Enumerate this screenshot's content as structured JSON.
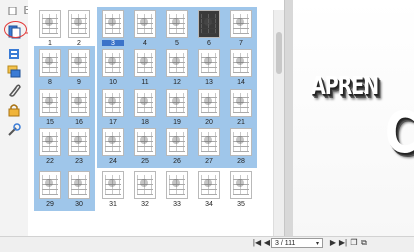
{
  "thumbnails": {
    "pages": [
      {
        "n": "1"
      },
      {
        "n": "2"
      },
      {
        "n": "3"
      },
      {
        "n": "4"
      },
      {
        "n": "5"
      },
      {
        "n": "6"
      },
      {
        "n": "7"
      },
      {
        "n": "8"
      },
      {
        "n": "9"
      },
      {
        "n": "10"
      },
      {
        "n": "11"
      },
      {
        "n": "12"
      },
      {
        "n": "13"
      },
      {
        "n": "14"
      },
      {
        "n": "15"
      },
      {
        "n": "16"
      },
      {
        "n": "17"
      },
      {
        "n": "18"
      },
      {
        "n": "19"
      },
      {
        "n": "20"
      },
      {
        "n": "21"
      },
      {
        "n": "22"
      },
      {
        "n": "23"
      },
      {
        "n": "24"
      },
      {
        "n": "25"
      },
      {
        "n": "26"
      },
      {
        "n": "27"
      },
      {
        "n": "28"
      },
      {
        "n": "29"
      },
      {
        "n": "30"
      },
      {
        "n": "31"
      },
      {
        "n": "32"
      },
      {
        "n": "33"
      },
      {
        "n": "34"
      },
      {
        "n": "35"
      }
    ],
    "current_page": "3",
    "selected_pages": [
      "3",
      "4",
      "5",
      "6",
      "7",
      "8",
      "9",
      "10",
      "11",
      "12",
      "13",
      "14",
      "15",
      "16",
      "17",
      "18",
      "19",
      "20",
      "21",
      "22",
      "23",
      "24",
      "25",
      "26",
      "27",
      "28",
      "29",
      "30"
    ]
  },
  "preview": {
    "title": "APREN",
    "subtitle": "Co"
  },
  "navigation": {
    "page_field": "3 / 111",
    "first_icon": "first-page-icon",
    "prev_icon": "prev-page-icon",
    "next_icon": "next-page-icon",
    "last_icon": "last-page-icon"
  },
  "colors": {
    "selection": "#9fc6ea",
    "current_label": "#3b73c9",
    "annotation": "#e23b3b"
  },
  "icons": [
    "page-thumbnails-icon",
    "bookmarks-icon",
    "comments-icon",
    "attachments-icon",
    "lock-icon",
    "tools-icon"
  ]
}
